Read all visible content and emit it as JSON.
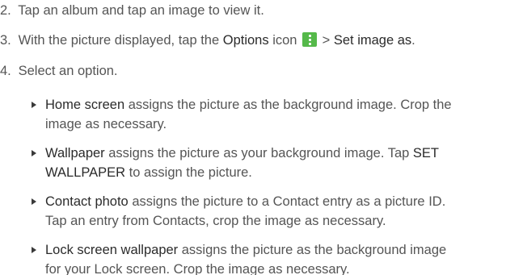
{
  "steps": [
    {
      "number": "2.",
      "text": "Tap an album and tap an image to view it."
    },
    {
      "number": "3.",
      "before": "With the picture displayed, tap the ",
      "options_label": "Options",
      "middle": " icon ",
      "after": " > ",
      "action_label": "Set image as",
      "end": ".",
      "icon": "options-vertical-dots-icon",
      "icon_color": "#55B94A"
    },
    {
      "number": "4.",
      "text": "Select an option."
    }
  ],
  "options": [
    {
      "term": "Home screen",
      "desc_line1": " assigns the picture as the background image. Crop the",
      "desc_line2": "image as necessary."
    },
    {
      "term": "Wallpaper",
      "desc_line1": " assigns the picture as your background image. Tap ",
      "term2_line1": "SET",
      "term2_line2": "WALLPAPER",
      "desc_line2": " to assign the picture."
    },
    {
      "term": "Contact photo",
      "desc_line1": " assigns the picture to a Contact entry as a picture ID.",
      "desc_line2": "Tap an entry from Contacts, crop the image as necessary."
    },
    {
      "term": "Lock screen wallpaper",
      "desc_line1": " assigns the picture as the background image",
      "desc_line2": "for your Lock screen. Crop the image as necessary."
    }
  ]
}
